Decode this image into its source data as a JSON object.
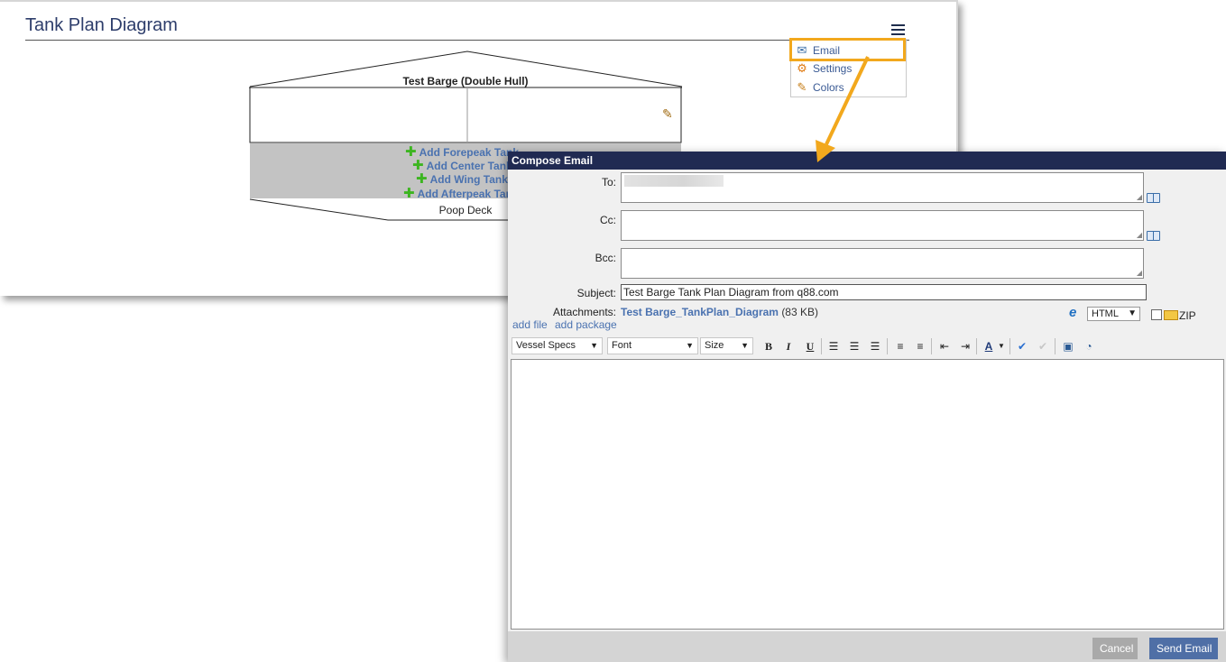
{
  "page": {
    "title": "Tank Plan Diagram",
    "menu": {
      "items": [
        {
          "label": "Email",
          "icon": "envelope-icon"
        },
        {
          "label": "Settings",
          "icon": "gear-icon"
        },
        {
          "label": "Colors",
          "icon": "pencil-icon"
        }
      ],
      "highlight_color": "#f2a81d"
    }
  },
  "barge": {
    "name": "Test Barge (Double Hull)",
    "add_links": [
      "Add Forepeak Tank",
      "Add Center Tank",
      "Add Wing Tank",
      "Add Afterpeak Tank"
    ],
    "deck_label": "Poop Deck",
    "colors": {
      "tank_band": "#c3c3c3",
      "link": "#4a72b0",
      "plus": "#3cb520"
    }
  },
  "dialog": {
    "title": "Compose Email",
    "labels": {
      "to": "To:",
      "cc": "Cc:",
      "bcc": "Bcc:",
      "subject": "Subject:",
      "attachments": "Attachments:"
    },
    "fields": {
      "to": "",
      "cc": "",
      "bcc": "",
      "subject": "Test Barge Tank Plan Diagram from q88.com"
    },
    "attachment": {
      "name": "Test Barge_TankPlan_Diagram",
      "size": "(83 KB)"
    },
    "add_file": "add file",
    "add_package": "add package",
    "format": "HTML",
    "zip_label": "ZIP",
    "toolbar": {
      "template_select": "Vessel Specs",
      "font_select": "Font",
      "size_select": "Size",
      "bold": "B",
      "italic": "I",
      "underline": "U"
    },
    "buttons": {
      "cancel": "Cancel",
      "send": "Send Email"
    },
    "colors": {
      "title_bar": "#202a52",
      "send": "#4f6fa6",
      "cancel": "#a9a9a9"
    }
  }
}
